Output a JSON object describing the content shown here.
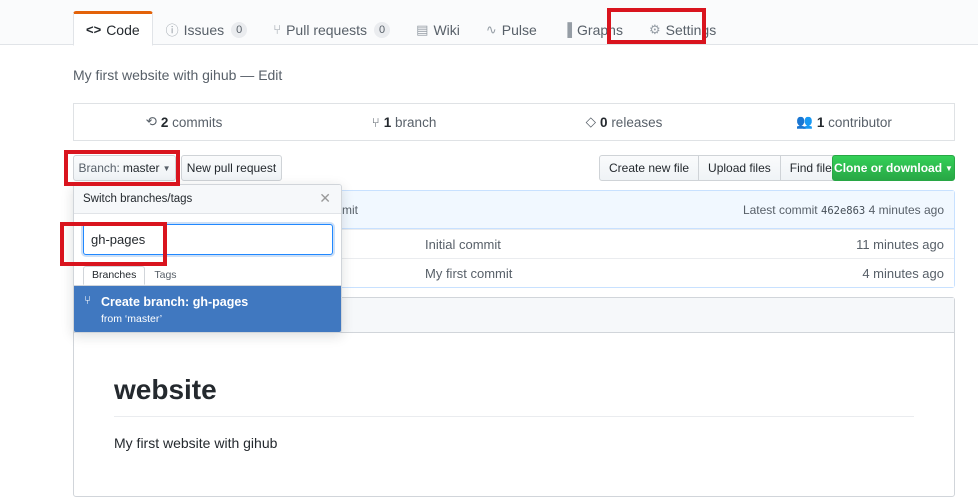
{
  "repo_nav": {
    "tabs": [
      {
        "label": "Code",
        "icon": "code-icon",
        "glyph": "<>",
        "counter": null
      },
      {
        "label": "Issues",
        "icon": "issue-icon",
        "glyph": "ⓘ",
        "counter": "0"
      },
      {
        "label": "Pull requests",
        "icon": "pull-request-icon",
        "glyph": "⑂",
        "counter": "0"
      },
      {
        "label": "Wiki",
        "icon": "book-icon",
        "glyph": "▤",
        "counter": null
      },
      {
        "label": "Pulse",
        "icon": "pulse-icon",
        "glyph": "∿",
        "counter": null
      },
      {
        "label": "Graphs",
        "icon": "graph-icon",
        "glyph": "▐",
        "counter": null
      },
      {
        "label": "Settings",
        "icon": "gear-icon",
        "glyph": "⚙",
        "counter": null
      }
    ],
    "selected": "Code"
  },
  "description": {
    "text": "My first website with gihub",
    "sep": " — ",
    "edit": "Edit"
  },
  "summary": {
    "commits_count": "2",
    "commits_label": " commits",
    "branch_count": "1",
    "branch_label": " branch",
    "releases_count": "0",
    "releases_label": " releases",
    "contributor_count": "1",
    "contributor_label": " contributor"
  },
  "toolbar": {
    "branch_label": "Branch:",
    "branch_name": "master",
    "new_pr": "New pull request",
    "create_file": "Create new file",
    "upload_files": "Upload files",
    "find_file": "Find file",
    "clone": "Clone or download"
  },
  "commit_bar": {
    "partial": "mit",
    "latest_label": "Latest commit",
    "sha": "462e863",
    "age": "4 minutes ago"
  },
  "files": [
    {
      "message": "Initial commit",
      "age": "11 minutes ago"
    },
    {
      "message": "My first commit",
      "age": "4 minutes ago"
    }
  ],
  "readme": {
    "heading": "website",
    "body": "My first website with gihub"
  },
  "branch_dropdown": {
    "title": "Switch branches/tags",
    "filter_value": "gh-pages",
    "tabs": [
      "Branches",
      "Tags"
    ],
    "create_line1": "Create branch: gh-pages",
    "create_line2": "from ‘master’"
  },
  "colors": {
    "accent_tab": "#e36209",
    "highlight": "#d9141e",
    "create_branch_bg": "#4078c0",
    "clone_green": "#28a745"
  }
}
